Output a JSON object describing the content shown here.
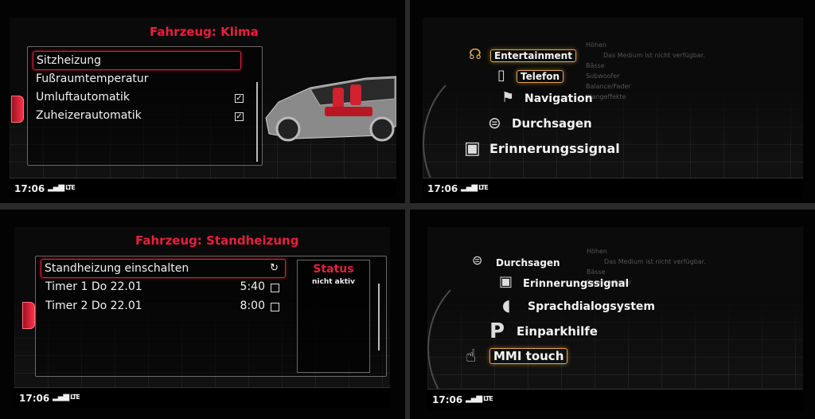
{
  "panel_klima": {
    "title": "Fahrzeug: Klima",
    "items": [
      {
        "label": "Sitzheizung"
      },
      {
        "label": "Fußraumtemperatur"
      },
      {
        "label": "Umluftautomatik",
        "checked": true
      },
      {
        "label": "Zuheizerautomatik",
        "checked": true
      }
    ],
    "check_glyph": "✓",
    "status": {
      "time": "17:06",
      "signal": "LTE"
    }
  },
  "panel_entertainment": {
    "items": [
      {
        "label": "Entertainment",
        "icon": "headphones-icon"
      },
      {
        "label": "Telefon",
        "icon": "phone-icon"
      },
      {
        "label": "Navigation",
        "icon": "flag-icon"
      },
      {
        "label": "Durchsagen",
        "icon": "announcement-icon"
      },
      {
        "label": "Erinnerungssignal",
        "icon": "reminder-icon"
      }
    ],
    "bg_list": [
      "Höhen",
      "Das Medium ist nicht verfügbar.",
      "Bässe",
      "Subwoofer",
      "Balance/Fader",
      "Klangeffekte"
    ],
    "status": {
      "time": "17:06",
      "signal": "LTE"
    }
  },
  "panel_standheizung": {
    "title": "Fahrzeug: Standheizung",
    "items": [
      {
        "label": "Standheizung einschalten"
      },
      {
        "label": "Timer 1 Do 22.01",
        "time": "5:40"
      },
      {
        "label": "Timer 2 Do 22.01",
        "time": "8:00"
      }
    ],
    "status_box": {
      "title": "Status",
      "value": "nicht aktiv"
    },
    "status": {
      "time": "17:06",
      "signal": "LTE"
    }
  },
  "panel_mmi": {
    "items": [
      {
        "label": "Durchsagen",
        "icon": "announcement-icon"
      },
      {
        "label": "Erinnerungssignal",
        "icon": "reminder-icon"
      },
      {
        "label": "Sprachdialogsystem",
        "icon": "voice-icon"
      },
      {
        "label": "Einparkhilfe",
        "icon": "parking-icon"
      },
      {
        "label": "MMI touch",
        "icon": "touch-icon"
      }
    ],
    "bg_list": [
      "Höhen",
      "Das Medium ist nicht verfügbar.",
      "Bässe",
      "Balance/Fader"
    ],
    "status": {
      "time": "17:06",
      "signal": "LTE"
    }
  }
}
